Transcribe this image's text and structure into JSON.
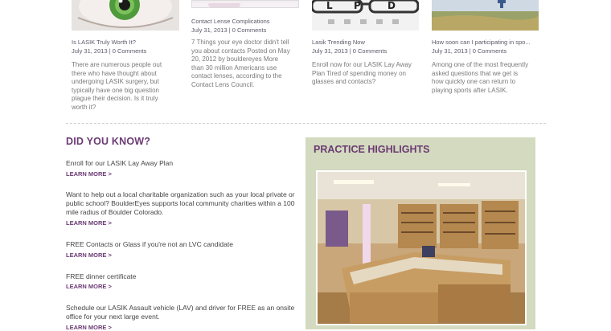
{
  "posts": [
    {
      "title": "Is LASIK Truly Worth It?",
      "meta": "July 31, 2013 | 0 Comments",
      "excerpt": "There are numerous people out there who have thought about undergoing LASIK surgery, but typically have one big question plague their decision. Is it truly worth it?",
      "thumb_icon": "eye-image"
    },
    {
      "title": "Contact Lense Complications",
      "meta": "July 31, 2013 | 0 Comments",
      "excerpt": "7 Things your eye doctor didn't tell you about contacts Posted on May 20, 2012 by bouldereyes More than 30 million Americans use contact lenses, according to the Contact Lens Council.",
      "thumb_icon": "contact-lens-image"
    },
    {
      "title": "Lasik Trending Now",
      "meta": "July 31, 2013 | 0 Comments",
      "excerpt": "Enroll now for our LASIK Lay Away Plan Tired of spending money on glasses and contacts?",
      "thumb_icon": "eye-chart-image",
      "chart_letters": [
        "L",
        "P",
        "D"
      ]
    },
    {
      "title": "How soon can I participating in spo...",
      "meta": "July 31, 2013 | 0 Comments",
      "excerpt": "Among one of the most frequently asked questions that we get is how quickly one can return to playing sports after LASIK.",
      "thumb_icon": "field-image"
    }
  ],
  "did_you_know": {
    "title": "DID YOU KNOW?",
    "items": [
      {
        "text": "Enroll for our LASIK Lay Away Plan",
        "link": "LEARN MORE >"
      },
      {
        "text": "Want to help out a local charitable organization such as your local private or public school? BoulderEyes supports local community charities within a 100 mile radius of Boulder Colorado.",
        "link": "LEARN MORE >"
      },
      {
        "text": "FREE Contacts or Glass if you're not an LVC candidate",
        "link": "LEARN MORE >"
      },
      {
        "text": "FREE dinner certificate",
        "link": "LEARN MORE >"
      },
      {
        "text": "Schedule our LASIK Assault vehicle (LAV) and driver for FREE as an onsite office for your next large event.",
        "link": "LEARN MORE >"
      }
    ]
  },
  "practice_highlights": {
    "title": "PRACTICE HIGHLIGHTS",
    "photo_icon": "optical-showroom-photo"
  },
  "colors": {
    "accent": "#6b3a73",
    "panel": "#d3dabf"
  }
}
